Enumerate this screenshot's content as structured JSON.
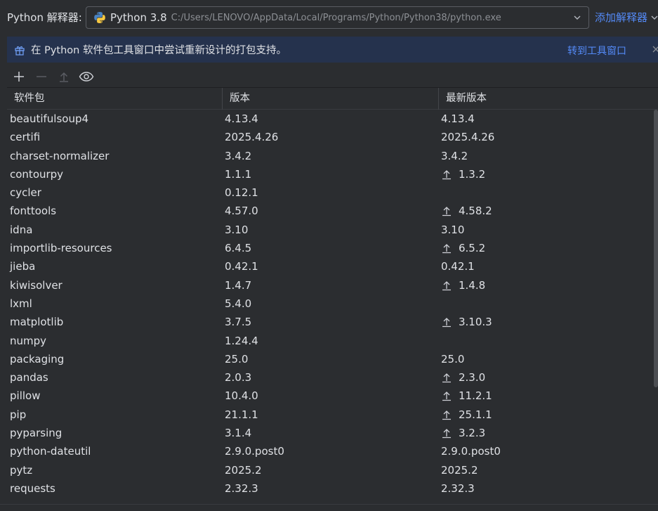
{
  "interpreter": {
    "label": "Python 解释器:",
    "name": "Python 3.8",
    "path": "C:/Users/LENOVO/AppData/Local/Programs/Python/Python38/python.exe",
    "add_label": "添加解释器"
  },
  "banner": {
    "text": "在 Python 软件包工具窗口中尝试重新设计的打包支持。",
    "link": "转到工具窗口"
  },
  "table": {
    "columns": [
      "软件包",
      "版本",
      "最新版本"
    ],
    "rows": [
      {
        "name": "beautifulsoup4",
        "version": "4.13.4",
        "latest": "4.13.4",
        "upgrade": false
      },
      {
        "name": "certifi",
        "version": "2025.4.26",
        "latest": "2025.4.26",
        "upgrade": false
      },
      {
        "name": "charset-normalizer",
        "version": "3.4.2",
        "latest": "3.4.2",
        "upgrade": false
      },
      {
        "name": "contourpy",
        "version": "1.1.1",
        "latest": "1.3.2",
        "upgrade": true
      },
      {
        "name": "cycler",
        "version": "0.12.1",
        "latest": "",
        "upgrade": false
      },
      {
        "name": "fonttools",
        "version": "4.57.0",
        "latest": "4.58.2",
        "upgrade": true
      },
      {
        "name": "idna",
        "version": "3.10",
        "latest": "3.10",
        "upgrade": false
      },
      {
        "name": "importlib-resources",
        "version": "6.4.5",
        "latest": "6.5.2",
        "upgrade": true
      },
      {
        "name": "jieba",
        "version": "0.42.1",
        "latest": "0.42.1",
        "upgrade": false
      },
      {
        "name": "kiwisolver",
        "version": "1.4.7",
        "latest": "1.4.8",
        "upgrade": true
      },
      {
        "name": "lxml",
        "version": "5.4.0",
        "latest": "",
        "upgrade": false
      },
      {
        "name": "matplotlib",
        "version": "3.7.5",
        "latest": "3.10.3",
        "upgrade": true
      },
      {
        "name": "numpy",
        "version": "1.24.4",
        "latest": "",
        "upgrade": false
      },
      {
        "name": "packaging",
        "version": "25.0",
        "latest": "25.0",
        "upgrade": false
      },
      {
        "name": "pandas",
        "version": "2.0.3",
        "latest": "2.3.0",
        "upgrade": true
      },
      {
        "name": "pillow",
        "version": "10.4.0",
        "latest": "11.2.1",
        "upgrade": true
      },
      {
        "name": "pip",
        "version": "21.1.1",
        "latest": "25.1.1",
        "upgrade": true
      },
      {
        "name": "pyparsing",
        "version": "3.1.4",
        "latest": "3.2.3",
        "upgrade": true
      },
      {
        "name": "python-dateutil",
        "version": "2.9.0.post0",
        "latest": "2.9.0.post0",
        "upgrade": false
      },
      {
        "name": "pytz",
        "version": "2025.2",
        "latest": "2025.2",
        "upgrade": false
      },
      {
        "name": "requests",
        "version": "2.32.3",
        "latest": "2.32.3",
        "upgrade": false
      }
    ]
  },
  "colors": {
    "background": "#2b2d30",
    "banner": "#25324d",
    "link": "#548af7",
    "text": "#dfe1e5"
  }
}
